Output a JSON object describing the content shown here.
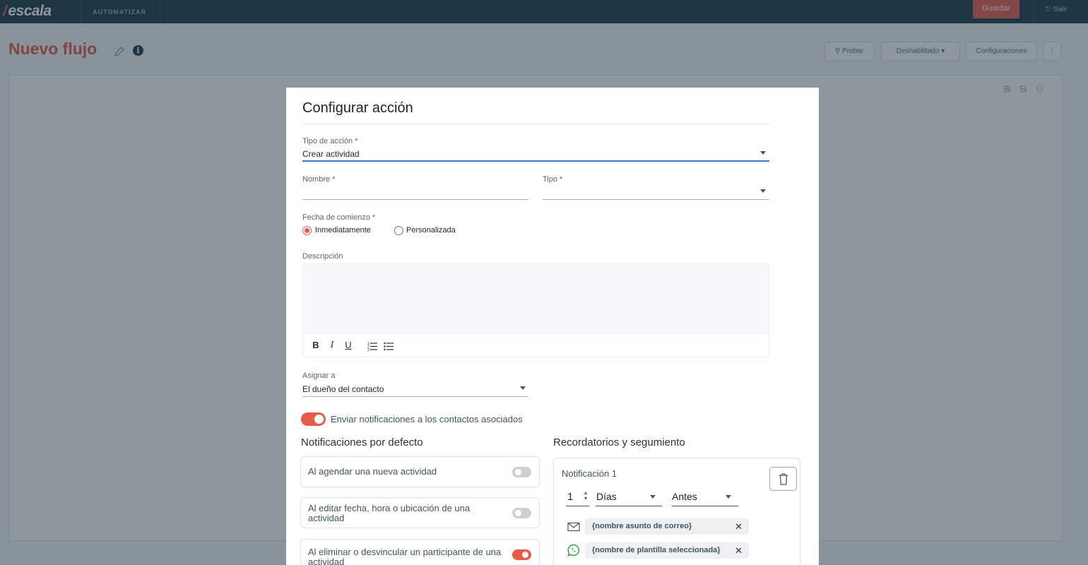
{
  "app": {
    "logo": "escala",
    "nav_item": "AUTOMATIZAR",
    "save_label": "Guardar",
    "logout_label": "Salir"
  },
  "page": {
    "title": "Nuevo flujo",
    "test_label": "Probar",
    "status_label": "Deshabilitado",
    "settings_label": "Configuraciones",
    "more_label": "⋮"
  },
  "modal": {
    "title": "Configurar acción",
    "action_type": {
      "label": "Tipo de acción *",
      "value": "Crear actividad"
    },
    "name": {
      "label": "Nombre *",
      "value": ""
    },
    "type": {
      "label": "Tipo *",
      "value": ""
    },
    "start_date": {
      "label": "Fecha de comienzo *",
      "options": [
        "Inmediatamente",
        "Personalizada"
      ],
      "selected": "Inmediatamente"
    },
    "description": {
      "label": "Descripción",
      "value": ""
    },
    "toolbar": {
      "bold": "B",
      "italic": "I",
      "underline": "U"
    },
    "assign": {
      "label": "Asignar a",
      "value": "El dueño del contacto"
    },
    "notify_contacts": {
      "label": "Enviar notificaciones a los contactos asociados",
      "on": true
    },
    "default_notifications": {
      "heading": "Notificaciones por defecto",
      "items": [
        {
          "label": "Al agendar una nueva actividad",
          "on": false
        },
        {
          "label": "Al editar fecha, hora o ubicación de una actividad",
          "on": false
        },
        {
          "label": "Al eliminar o desvincular un participante de una actividad",
          "on": true
        }
      ]
    },
    "reminders": {
      "heading": "Recordatorios y segumiento",
      "card_title": "Notificación 1",
      "amount": "1",
      "unit": "Días",
      "timing": "Antes",
      "email_chip": "{nombre asunto de correo}",
      "whatsapp_chip": "{nombre de plantilla seleccionada}",
      "remove_symbol": "✕"
    }
  },
  "colors": {
    "brand": "#e85b47",
    "topbar": "#1f3a4a",
    "focus": "#3b78c4"
  }
}
